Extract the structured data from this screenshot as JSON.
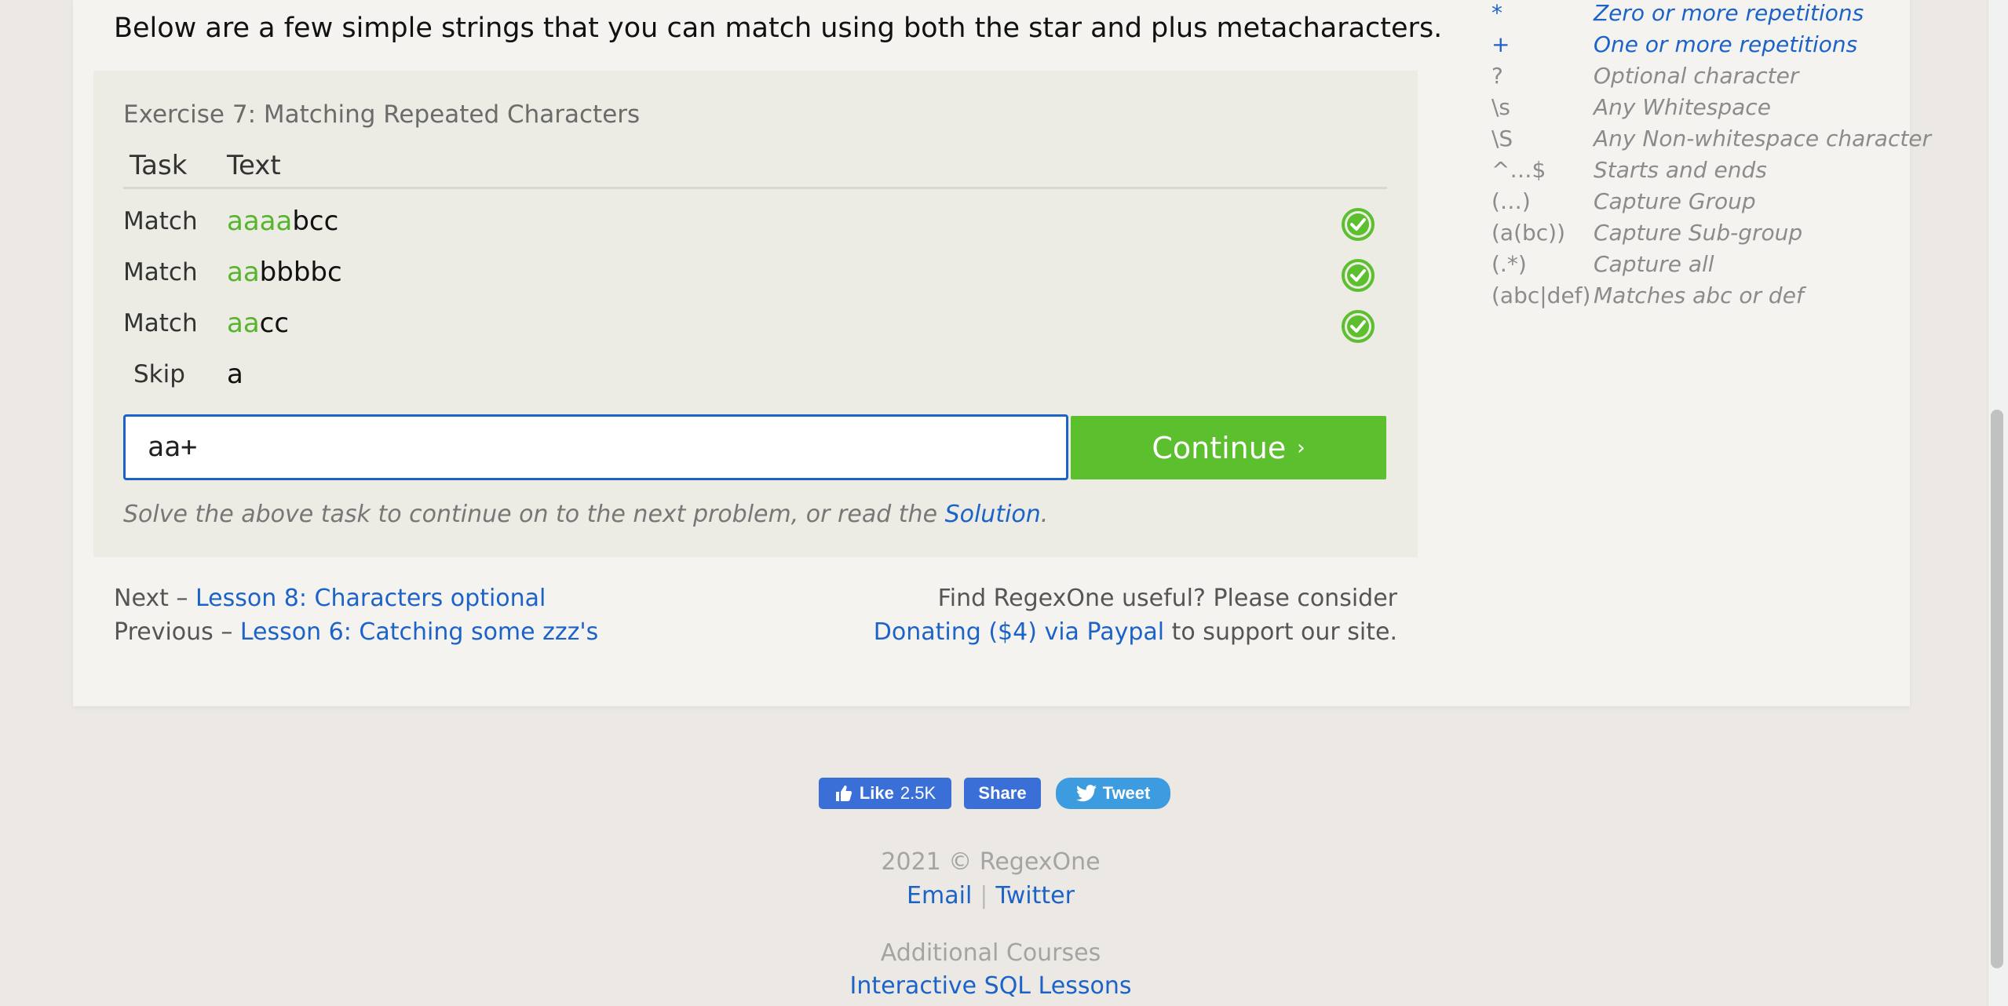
{
  "intro": "Below are a few simple strings that you can match using both the star and plus metacharacters.",
  "exercise": {
    "title": "Exercise 7: Matching Repeated Characters",
    "headers": {
      "task": "Task",
      "text": "Text"
    },
    "rows": [
      {
        "task": "Match",
        "matched": "aaaa",
        "rest": "bcc",
        "status": "check-icon"
      },
      {
        "task": "Match",
        "matched": "aa",
        "rest": "bbbbc",
        "status": "check-icon"
      },
      {
        "task": "Match",
        "matched": "aa",
        "rest": "cc",
        "status": "check-icon"
      },
      {
        "task": "Skip",
        "matched": "",
        "rest": "a",
        "status": ""
      }
    ],
    "input_value": "aa+",
    "continue_label": "Continue",
    "continue_chevron": "›",
    "hint_prefix": "Solve the above task to continue on to the next problem, or read the",
    "hint_link": "Solution",
    "hint_suffix": "."
  },
  "nav": {
    "next_prefix": "Next –",
    "next_link": "Lesson 8: Characters optional",
    "prev_prefix": "Previous –",
    "prev_link": "Lesson 6: Catching some zzz's",
    "donate_line1": "Find RegexOne useful? Please consider",
    "donate_link": "Donating ($4) via Paypal",
    "donate_suffix": "to support our site."
  },
  "reference": [
    {
      "symbol": "*",
      "desc": "Zero or more repetitions",
      "highlight": true
    },
    {
      "symbol": "+",
      "desc": "One or more repetitions",
      "highlight": true
    },
    {
      "symbol": "?",
      "desc": "Optional character",
      "highlight": false
    },
    {
      "symbol": "\\s",
      "desc": "Any Whitespace",
      "highlight": false
    },
    {
      "symbol": "\\S",
      "desc": "Any Non-whitespace character",
      "highlight": false
    },
    {
      "symbol": "^…$",
      "desc": "Starts and ends",
      "highlight": false
    },
    {
      "symbol": "(…)",
      "desc": "Capture Group",
      "highlight": false
    },
    {
      "symbol": "(a(bc))",
      "desc": "Capture Sub-group",
      "highlight": false
    },
    {
      "symbol": "(.*)",
      "desc": "Capture all",
      "highlight": false
    },
    {
      "symbol": "(abc|def)",
      "desc": "Matches abc or def",
      "highlight": false
    }
  ],
  "social": {
    "like_label": "Like",
    "like_count": "2.5K",
    "share_label": "Share",
    "tweet_label": "Tweet"
  },
  "footer": {
    "copyright": "2021 © RegexOne",
    "email": "Email",
    "separator": "|",
    "twitter": "Twitter",
    "additional": "Additional Courses",
    "sql": "Interactive SQL Lessons"
  },
  "colors": {
    "accent_green": "#5cbf2e",
    "match_green": "#56b52c",
    "link_blue": "#1b63c9"
  }
}
